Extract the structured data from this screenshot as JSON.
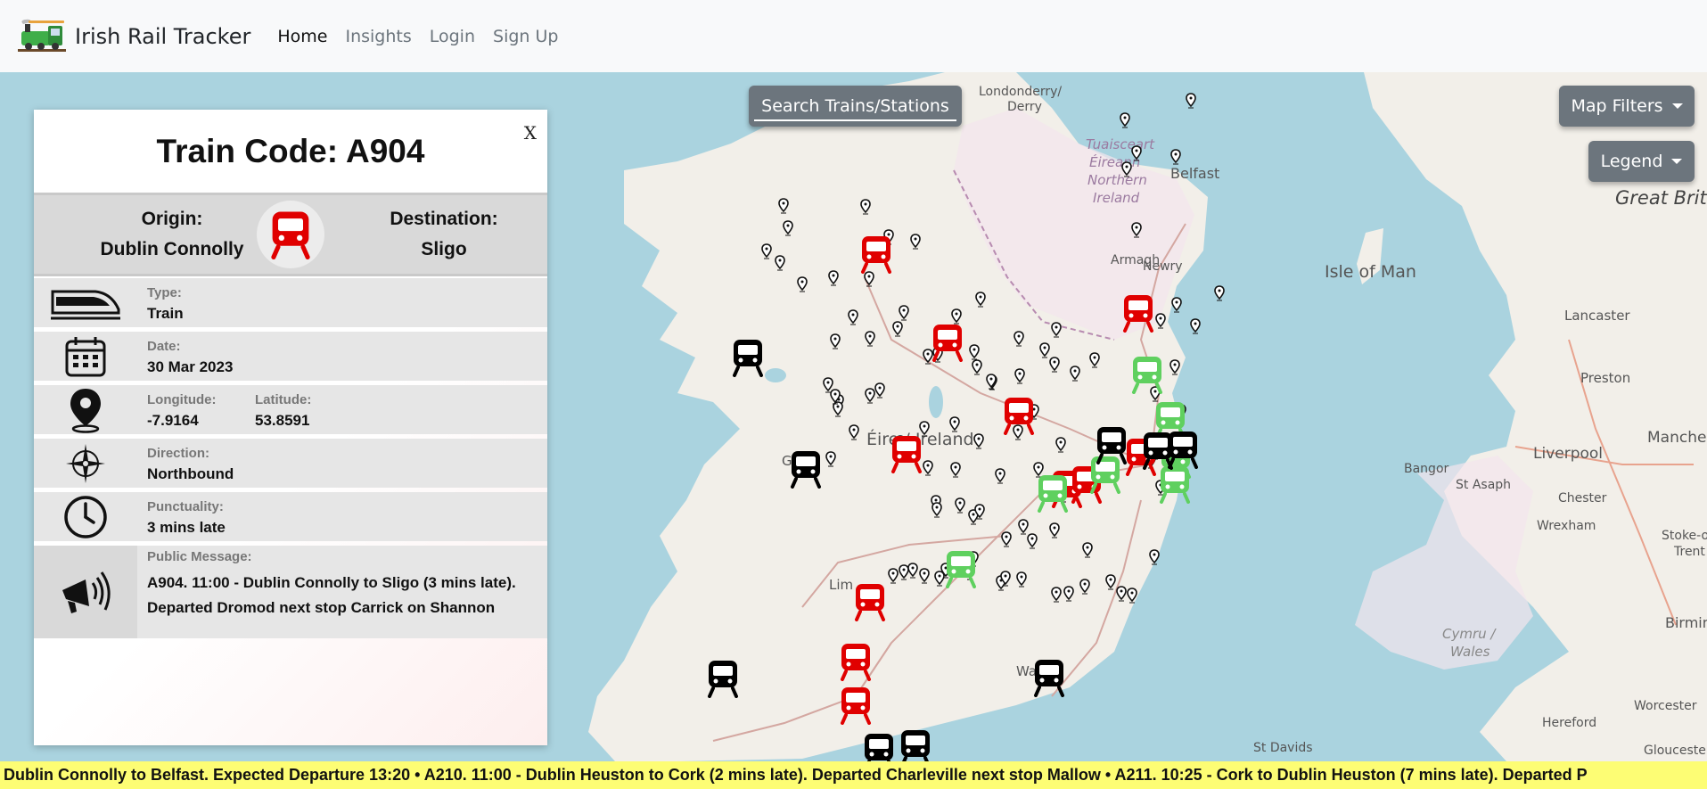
{
  "navbar": {
    "brand": "Irish Rail Tracker",
    "links": [
      "Home",
      "Insights",
      "Login",
      "Sign Up"
    ]
  },
  "map": {
    "search_label": "Search Trains/Stations",
    "filters_label": "Map Filters",
    "legend_label": "Legend",
    "labels": [
      "Londonderry/",
      "Derry",
      "Tuaisceart",
      "Éireann",
      "Northern",
      "Ireland",
      "Belfast",
      "Armagh",
      "Newry",
      "Isle of Man",
      "Great Brit",
      "Éire / Ireland",
      "Lancaster",
      "Preston",
      "Liverpool",
      "Manchester",
      "Bangor",
      "St Asaph",
      "Chester",
      "Wrexham",
      "Stoke-on-",
      "Trent",
      "Cymru /",
      "Wales",
      "Birmin",
      "Hereford",
      "Worcester",
      "St Davids",
      "Gloucester",
      "Ga",
      "Lim",
      "Wa"
    ]
  },
  "panel": {
    "close": "X",
    "title": "Train Code: A904",
    "origin_label": "Origin:",
    "origin_value": "Dublin Connolly",
    "destination_label": "Destination:",
    "destination_value": "Sligo",
    "type_label": "Type:",
    "type_value": "Train",
    "date_label": "Date:",
    "date_value": "30 Mar 2023",
    "longitude_label": "Longitude:",
    "longitude_value": "-7.9164",
    "latitude_label": "Latitude:",
    "latitude_value": "53.8591",
    "direction_label": "Direction:",
    "direction_value": "Northbound",
    "punctuality_label": "Punctuality:",
    "punctuality_value": "3 mins late",
    "message_label": "Public Message:",
    "message_value": "A904. 11:00 - Dublin Connolly to Sligo (3 mins late). Departed Dromod next stop Carrick on Shannon"
  },
  "ticker": {
    "text": "Dublin Connolly to Belfast. Expected Departure 13:20 • A210. 11:00 - Dublin Heuston to Cork (2 mins late). Departed Charleville next stop Mallow • A211. 10:25 - Cork to Dublin Heuston (7 mins late). Departed P"
  },
  "colors": {
    "late": "#e00000",
    "on_time": "#5fd05f",
    "not_running": "#000000",
    "ticker": "#fdfd74",
    "sea": "#aad3df",
    "land": "#f2efe9",
    "button": "#6c757d"
  }
}
